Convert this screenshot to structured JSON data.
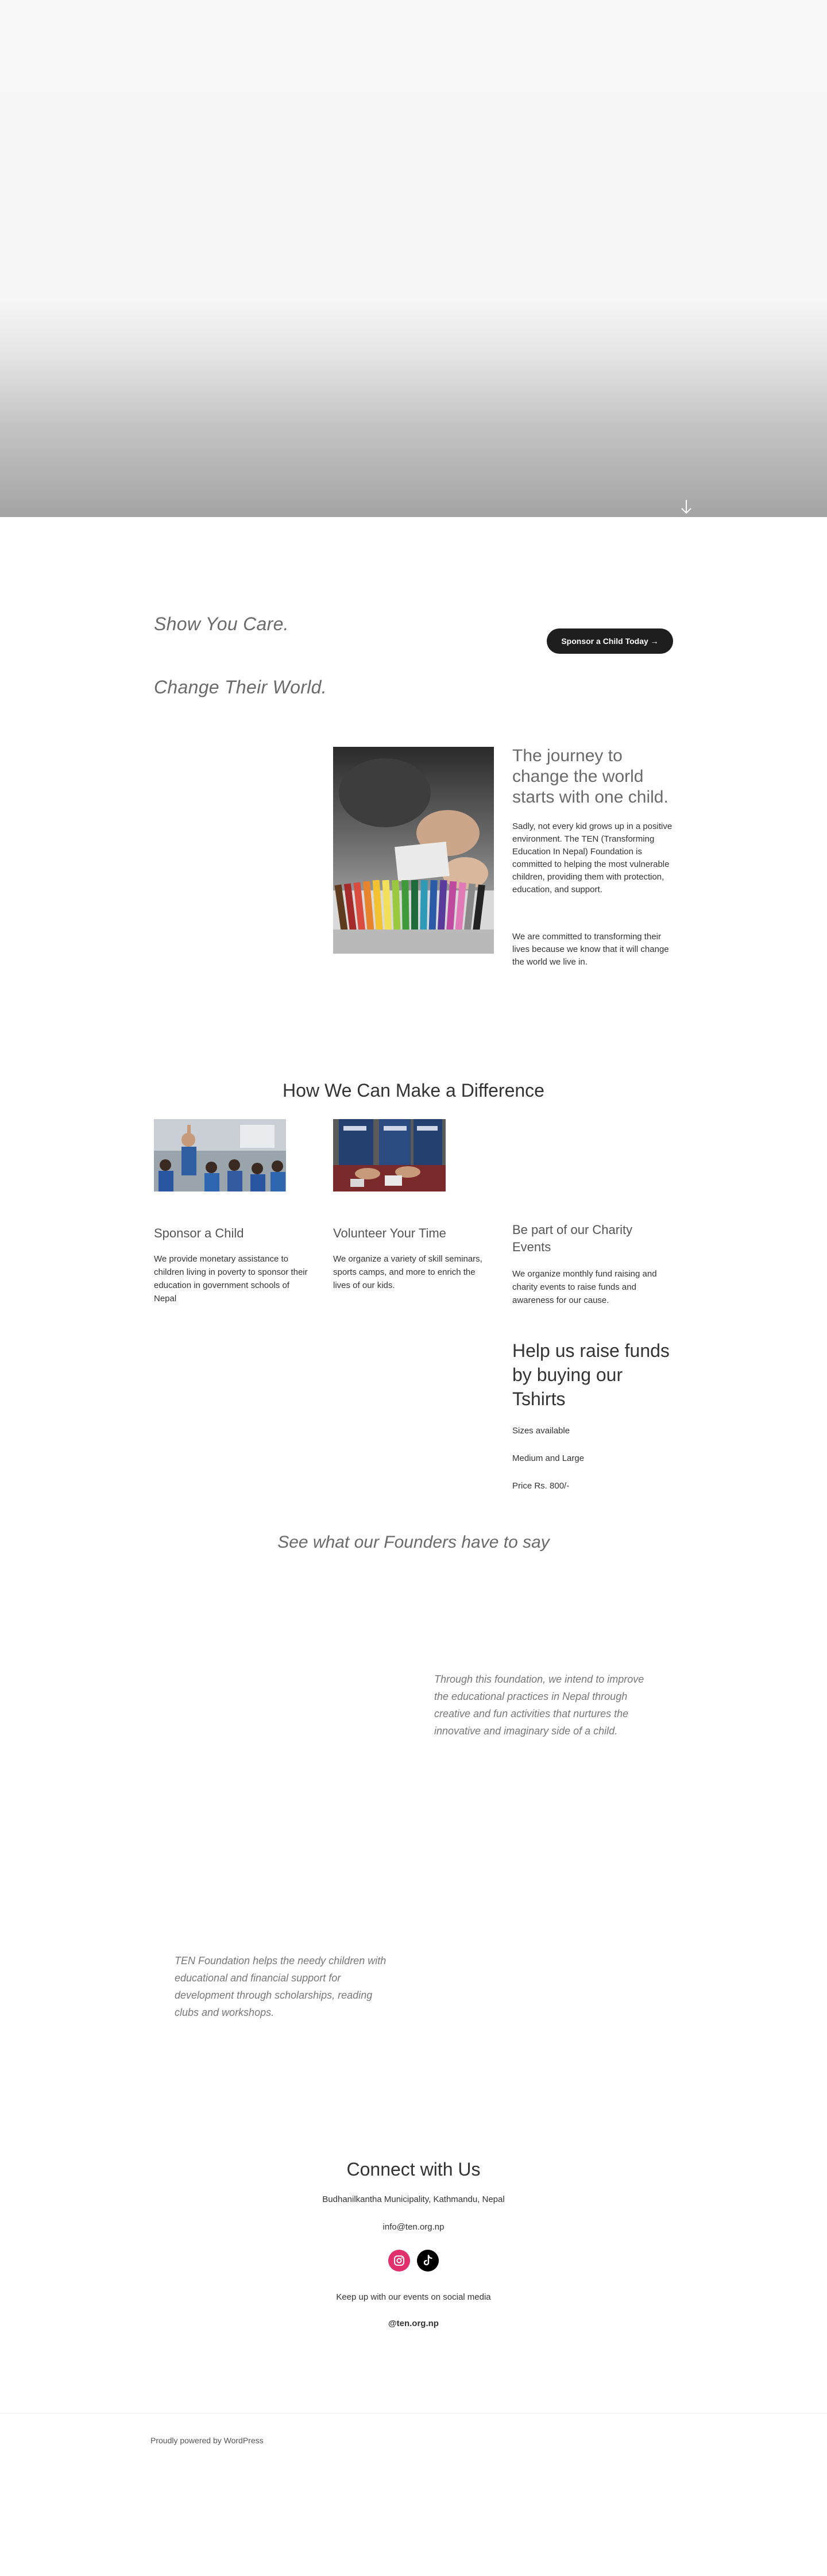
{
  "hero": {
    "scroll_icon": "arrow-down-icon"
  },
  "intro": {
    "tagline_1": "Show You Care.",
    "tagline_2": "Change Their World.",
    "sponsor_button": "Sponsor a Child Today →"
  },
  "journey": {
    "title": "The journey to change the world starts with one child.",
    "paragraph_1": "Sadly, not every kid grows up in a positive environment. The TEN (Transforming Education In Nepal) Foundation is committed to helping the most vulnerable children, providing them with protection, education, and support.",
    "paragraph_2": "We are committed to transforming their lives because we know that it will change the world we live in."
  },
  "difference": {
    "title": "How We Can Make a Difference",
    "cards": [
      {
        "title": "Sponsor a Child",
        "text": "We provide monetary assistance to children living in poverty to sponsor their education in government schools of Nepal"
      },
      {
        "title": "Volunteer Your Time",
        "text": "We organize a variety of skill seminars, sports camps, and more to enrich the lives of our kids."
      },
      {
        "title": "Be part of our Charity Events",
        "text": "We organize monthly fund raising and charity events to raise funds and awareness for our cause."
      }
    ]
  },
  "tshirts": {
    "title": "Help us raise funds by buying our Tshirts",
    "line_1": "Sizes available",
    "line_2": "Medium and Large",
    "line_3": "Price Rs. 800/-"
  },
  "founders": {
    "title": "See what our Founders have to say",
    "quote_1": "Through this foundation, we intend to improve the educational practices in Nepal through creative and fun activities that nurtures the innovative and imaginary side of a child.",
    "quote_2": "TEN Foundation helps the needy children with educational and financial support for development through scholarships, reading clubs and workshops."
  },
  "connect": {
    "title": "Connect with Us",
    "address": "Budhanilkantha Municipality, Kathmandu, Nepal",
    "email": "info@ten.org.np",
    "social_icons": [
      "instagram-icon",
      "tiktok-icon"
    ],
    "keep_up": "Keep up with our events on social media",
    "handle": "@ten.org.np"
  },
  "footer": {
    "text": "Proudly powered by WordPress"
  },
  "colors": {
    "button_bg": "#1e1e1e",
    "instagram": "#e1306c",
    "tiktok": "#000000"
  }
}
